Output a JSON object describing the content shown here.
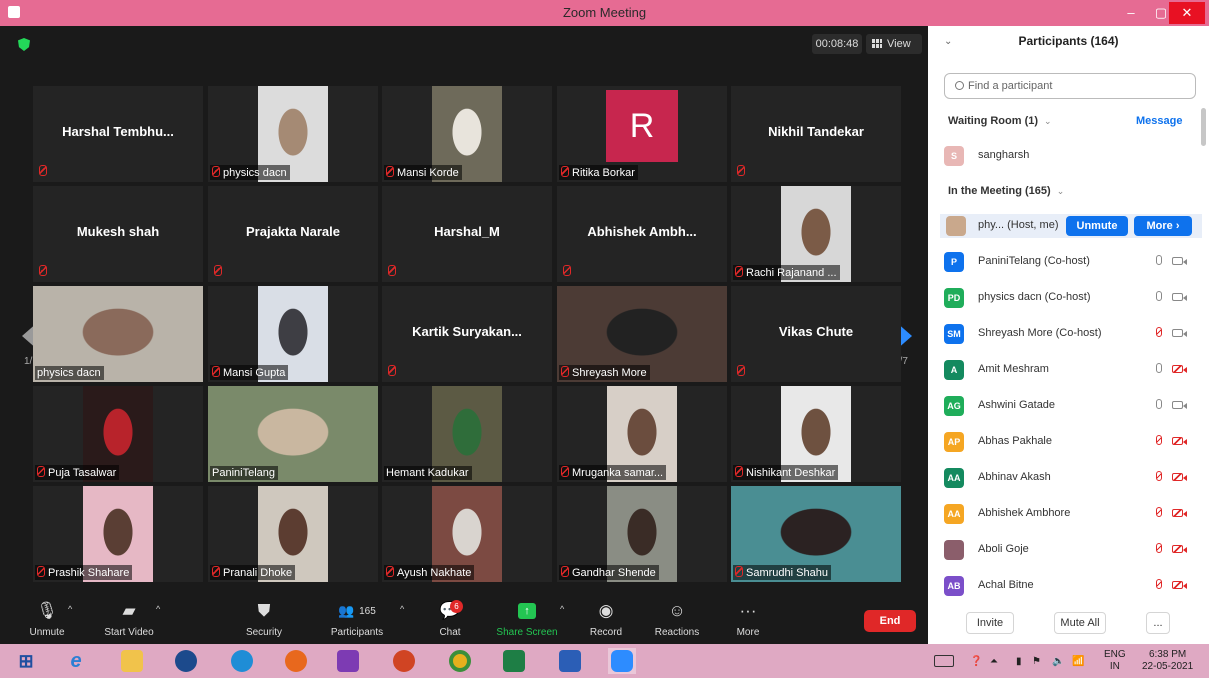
{
  "window": {
    "title": "Zoom Meeting",
    "minimize": "–",
    "maximize": "▢",
    "close": "✕"
  },
  "meeting": {
    "timer": "00:08:48",
    "view_label": "View",
    "page_left": "1/7",
    "page_right": "1/7"
  },
  "tiles": [
    {
      "name": "Harshal  Tembhu...",
      "mode": "name"
    },
    {
      "name": "physics dacn",
      "mode": "photo",
      "photo_color": "#dcdcdc",
      "accent": "#a58a74"
    },
    {
      "name": "Mansi Korde",
      "mode": "photo",
      "photo_color": "#6e6a5a",
      "accent": "#e8e4dc"
    },
    {
      "name": "Ritika Borkar",
      "mode": "avatar",
      "initial": "R"
    },
    {
      "name": "Nikhil Tandekar",
      "mode": "name"
    },
    {
      "name": "Mukesh shah",
      "mode": "name"
    },
    {
      "name": "Prajakta Narale",
      "mode": "name"
    },
    {
      "name": "Harshal_M",
      "mode": "name"
    },
    {
      "name": "Abhishek  Ambh...",
      "mode": "name"
    },
    {
      "name": "Rachi  Rajanand ...",
      "mode": "photo",
      "photo_color": "#d7d7d7",
      "accent": "#7b5b47"
    },
    {
      "name": "physics dacn",
      "mode": "photo",
      "photo_color": "#b9b3a9",
      "accent": "#8a6a5b"
    },
    {
      "name": "Mansi Gupta",
      "mode": "photo",
      "photo_color": "#d9dee6",
      "accent": "#3e3e44"
    },
    {
      "name": "Kartik  Suryakan...",
      "mode": "name"
    },
    {
      "name": "Shreyash More",
      "mode": "photo",
      "photo_color": "#4c3b35",
      "accent": "#222"
    },
    {
      "name": "Vikas Chute",
      "mode": "name"
    },
    {
      "name": "Puja Tasalwar",
      "mode": "photo",
      "photo_color": "#2a1a1a",
      "accent": "#b8232b"
    },
    {
      "name": "PaniniTelang",
      "mode": "photo",
      "photo_color": "#7a8a6a",
      "accent": "#c9b7a0"
    },
    {
      "name": "Hemant Kadukar",
      "mode": "photo",
      "photo_color": "#5c5a44",
      "accent": "#2f6d3a"
    },
    {
      "name": "Mruganka samar...",
      "mode": "photo",
      "photo_color": "#d7cfc7",
      "accent": "#6b4d3e"
    },
    {
      "name": "Nishikant Deshkar",
      "mode": "photo",
      "photo_color": "#e8e8e8",
      "accent": "#6e5140"
    },
    {
      "name": "Prashik Shahare",
      "mode": "photo",
      "photo_color": "#e6b8c5",
      "accent": "#5a3e34"
    },
    {
      "name": "Pranali Dhoke",
      "mode": "photo",
      "photo_color": "#cfc8be",
      "accent": "#5c3d31"
    },
    {
      "name": "Ayush Nakhate",
      "mode": "photo",
      "photo_color": "#7c4a42",
      "accent": "#d9d4cf"
    },
    {
      "name": "Gandhar Shende",
      "mode": "photo",
      "photo_color": "#8a8d84",
      "accent": "#3a2c26"
    },
    {
      "name": "Samrudhi Shahu",
      "mode": "photo",
      "photo_color": "#4a8e93",
      "accent": "#2b2222"
    }
  ],
  "toolbar": {
    "unmute": "Unmute",
    "start_video": "Start Video",
    "security": "Security",
    "participants": "Participants",
    "participants_count": "165",
    "chat": "Chat",
    "chat_badge": "6",
    "share_screen": "Share Screen",
    "record": "Record",
    "reactions": "Reactions",
    "more": "More",
    "end": "End"
  },
  "panel": {
    "header": "Participants (164)",
    "search_placeholder": "Find a participant",
    "waiting_room": "Waiting Room (1)",
    "message": "Message",
    "waiting_participant": "sangharsh",
    "waiting_initial": "S",
    "in_meeting": "In the Meeting (165)",
    "host_name": "phy... (Host, me)",
    "unmute_btn": "Unmute",
    "more_btn": "More ›",
    "participants": [
      {
        "initials": "P",
        "name": "PaniniTelang (Co-host)",
        "color": "#0e72ed",
        "mic": "on",
        "cam": "on"
      },
      {
        "initials": "PD",
        "name": "physics dacn (Co-host)",
        "color": "#1fad5a",
        "mic": "on",
        "cam": "on"
      },
      {
        "initials": "SM",
        "name": "Shreyash More (Co-host)",
        "color": "#0e72ed",
        "mic": "off",
        "cam": "on"
      },
      {
        "initials": "A",
        "name": "Amit Meshram",
        "color": "#148a5f",
        "mic": "on",
        "cam": "off"
      },
      {
        "initials": "AG",
        "name": "Ashwini Gatade",
        "color": "#1fad5a",
        "mic": "on",
        "cam": "on"
      },
      {
        "initials": "AP",
        "name": "Abhas Pakhale",
        "color": "#f5a623",
        "mic": "off",
        "cam": "off"
      },
      {
        "initials": "AA",
        "name": "Abhinav Akash",
        "color": "#148a5f",
        "mic": "off",
        "cam": "off"
      },
      {
        "initials": "AA",
        "name": "Abhishek Ambhore",
        "color": "#f5a623",
        "mic": "off",
        "cam": "off"
      },
      {
        "initials": "",
        "name": "Aboli Goje",
        "color": "#8b5e6b",
        "mic": "off",
        "cam": "off"
      },
      {
        "initials": "AB",
        "name": "Achal Bitne",
        "color": "#7b4fc9",
        "mic": "off",
        "cam": "off"
      }
    ],
    "invite": "Invite",
    "mute_all": "Mute All",
    "more_dots": "..."
  },
  "taskbar": {
    "lang_top": "ENG",
    "lang_bottom": "IN",
    "time": "6:38 PM",
    "date": "22-05-2021"
  }
}
